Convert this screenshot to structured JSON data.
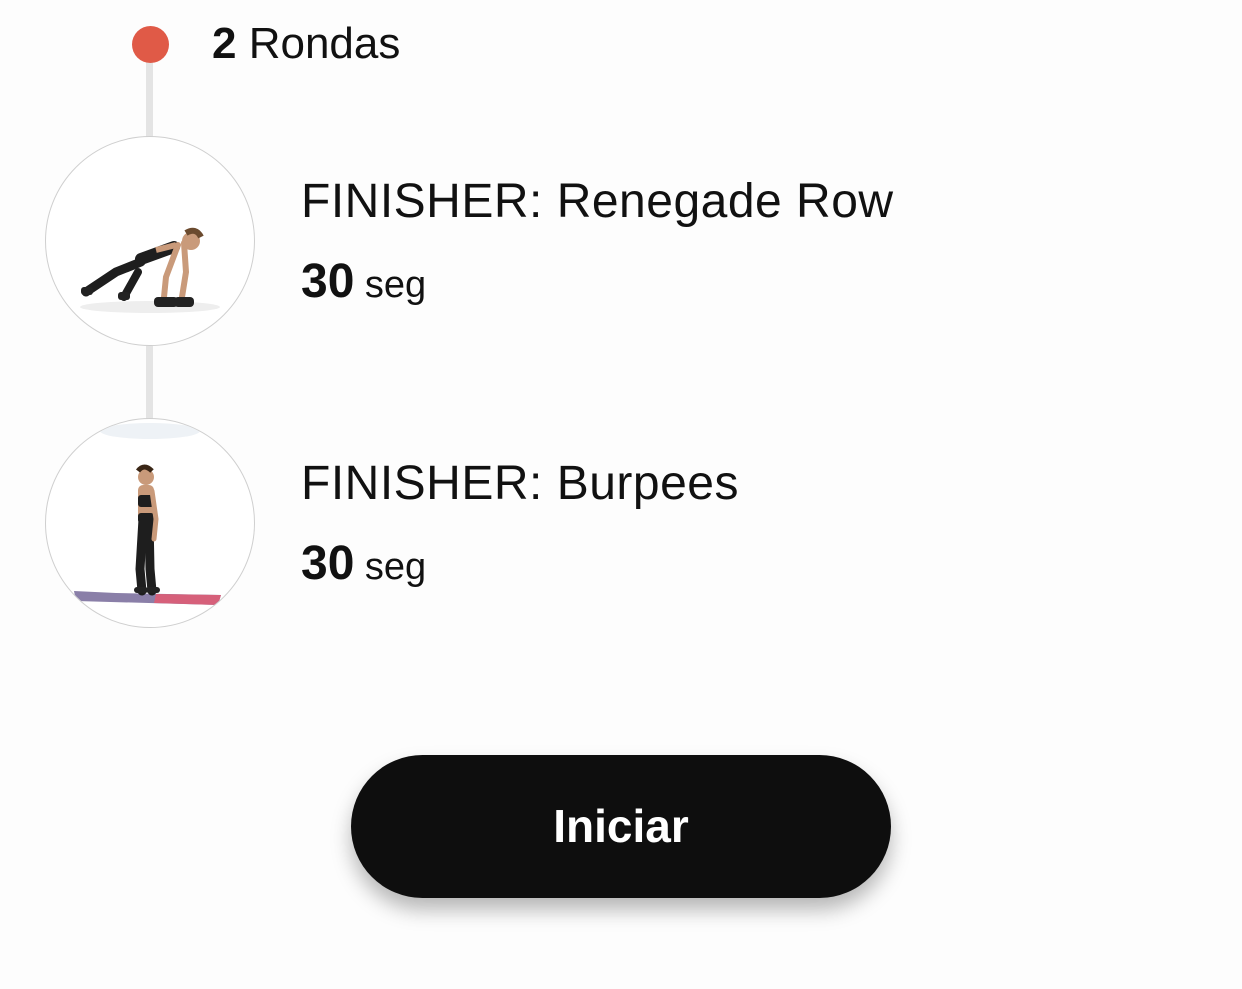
{
  "round": {
    "count": "2",
    "label": "Rondas",
    "dot_color": "#e05a47"
  },
  "exercises": [
    {
      "title": "FINISHER: Renegade Row",
      "duration_value": "30",
      "duration_unit": "seg",
      "image_icon": "renegade-row-figure"
    },
    {
      "title": "FINISHER: Burpees",
      "duration_value": "30",
      "duration_unit": "seg",
      "image_icon": "standing-figure"
    }
  ],
  "start_button": {
    "label": "Iniciar",
    "background": "#0e0e0e",
    "text_color": "#ffffff"
  }
}
